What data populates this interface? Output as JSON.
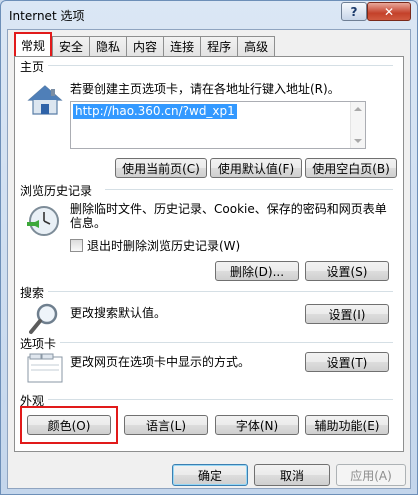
{
  "window": {
    "title": "Internet 选项",
    "help_glyph": "?",
    "close_glyph": "✕"
  },
  "tabs": [
    "常规",
    "安全",
    "隐私",
    "内容",
    "连接",
    "程序",
    "高级"
  ],
  "homepage": {
    "label": "主页",
    "description": "若要创建主页选项卡，请在各地址行键入地址(R)。",
    "url": "http://hao.360.cn/?wd_xp1",
    "buttons": [
      "使用当前页(C)",
      "使用默认值(F)",
      "使用空白页(B)"
    ]
  },
  "history": {
    "label": "浏览历史记录",
    "description": "删除临时文件、历史记录、Cookie、保存的密码和网页表单信息。",
    "checkbox_label": "退出时删除浏览历史记录(W)",
    "delete_button": "删除(D)...",
    "settings_button": "设置(S)"
  },
  "search": {
    "label": "搜索",
    "description": "更改搜索默认值。",
    "settings_button": "设置(I)"
  },
  "tabbed": {
    "label": "选项卡",
    "description": "更改网页在选项卡中显示的方式。",
    "settings_button": "设置(T)"
  },
  "appearance": {
    "label": "外观",
    "buttons": [
      "颜色(O)",
      "语言(L)",
      "字体(N)",
      "辅助功能(E)"
    ]
  },
  "footer": {
    "ok": "确定",
    "cancel": "取消",
    "apply": "应用(A)"
  },
  "colors": {
    "highlight_red": "#e11a1a",
    "selection_blue": "#3399ff"
  }
}
